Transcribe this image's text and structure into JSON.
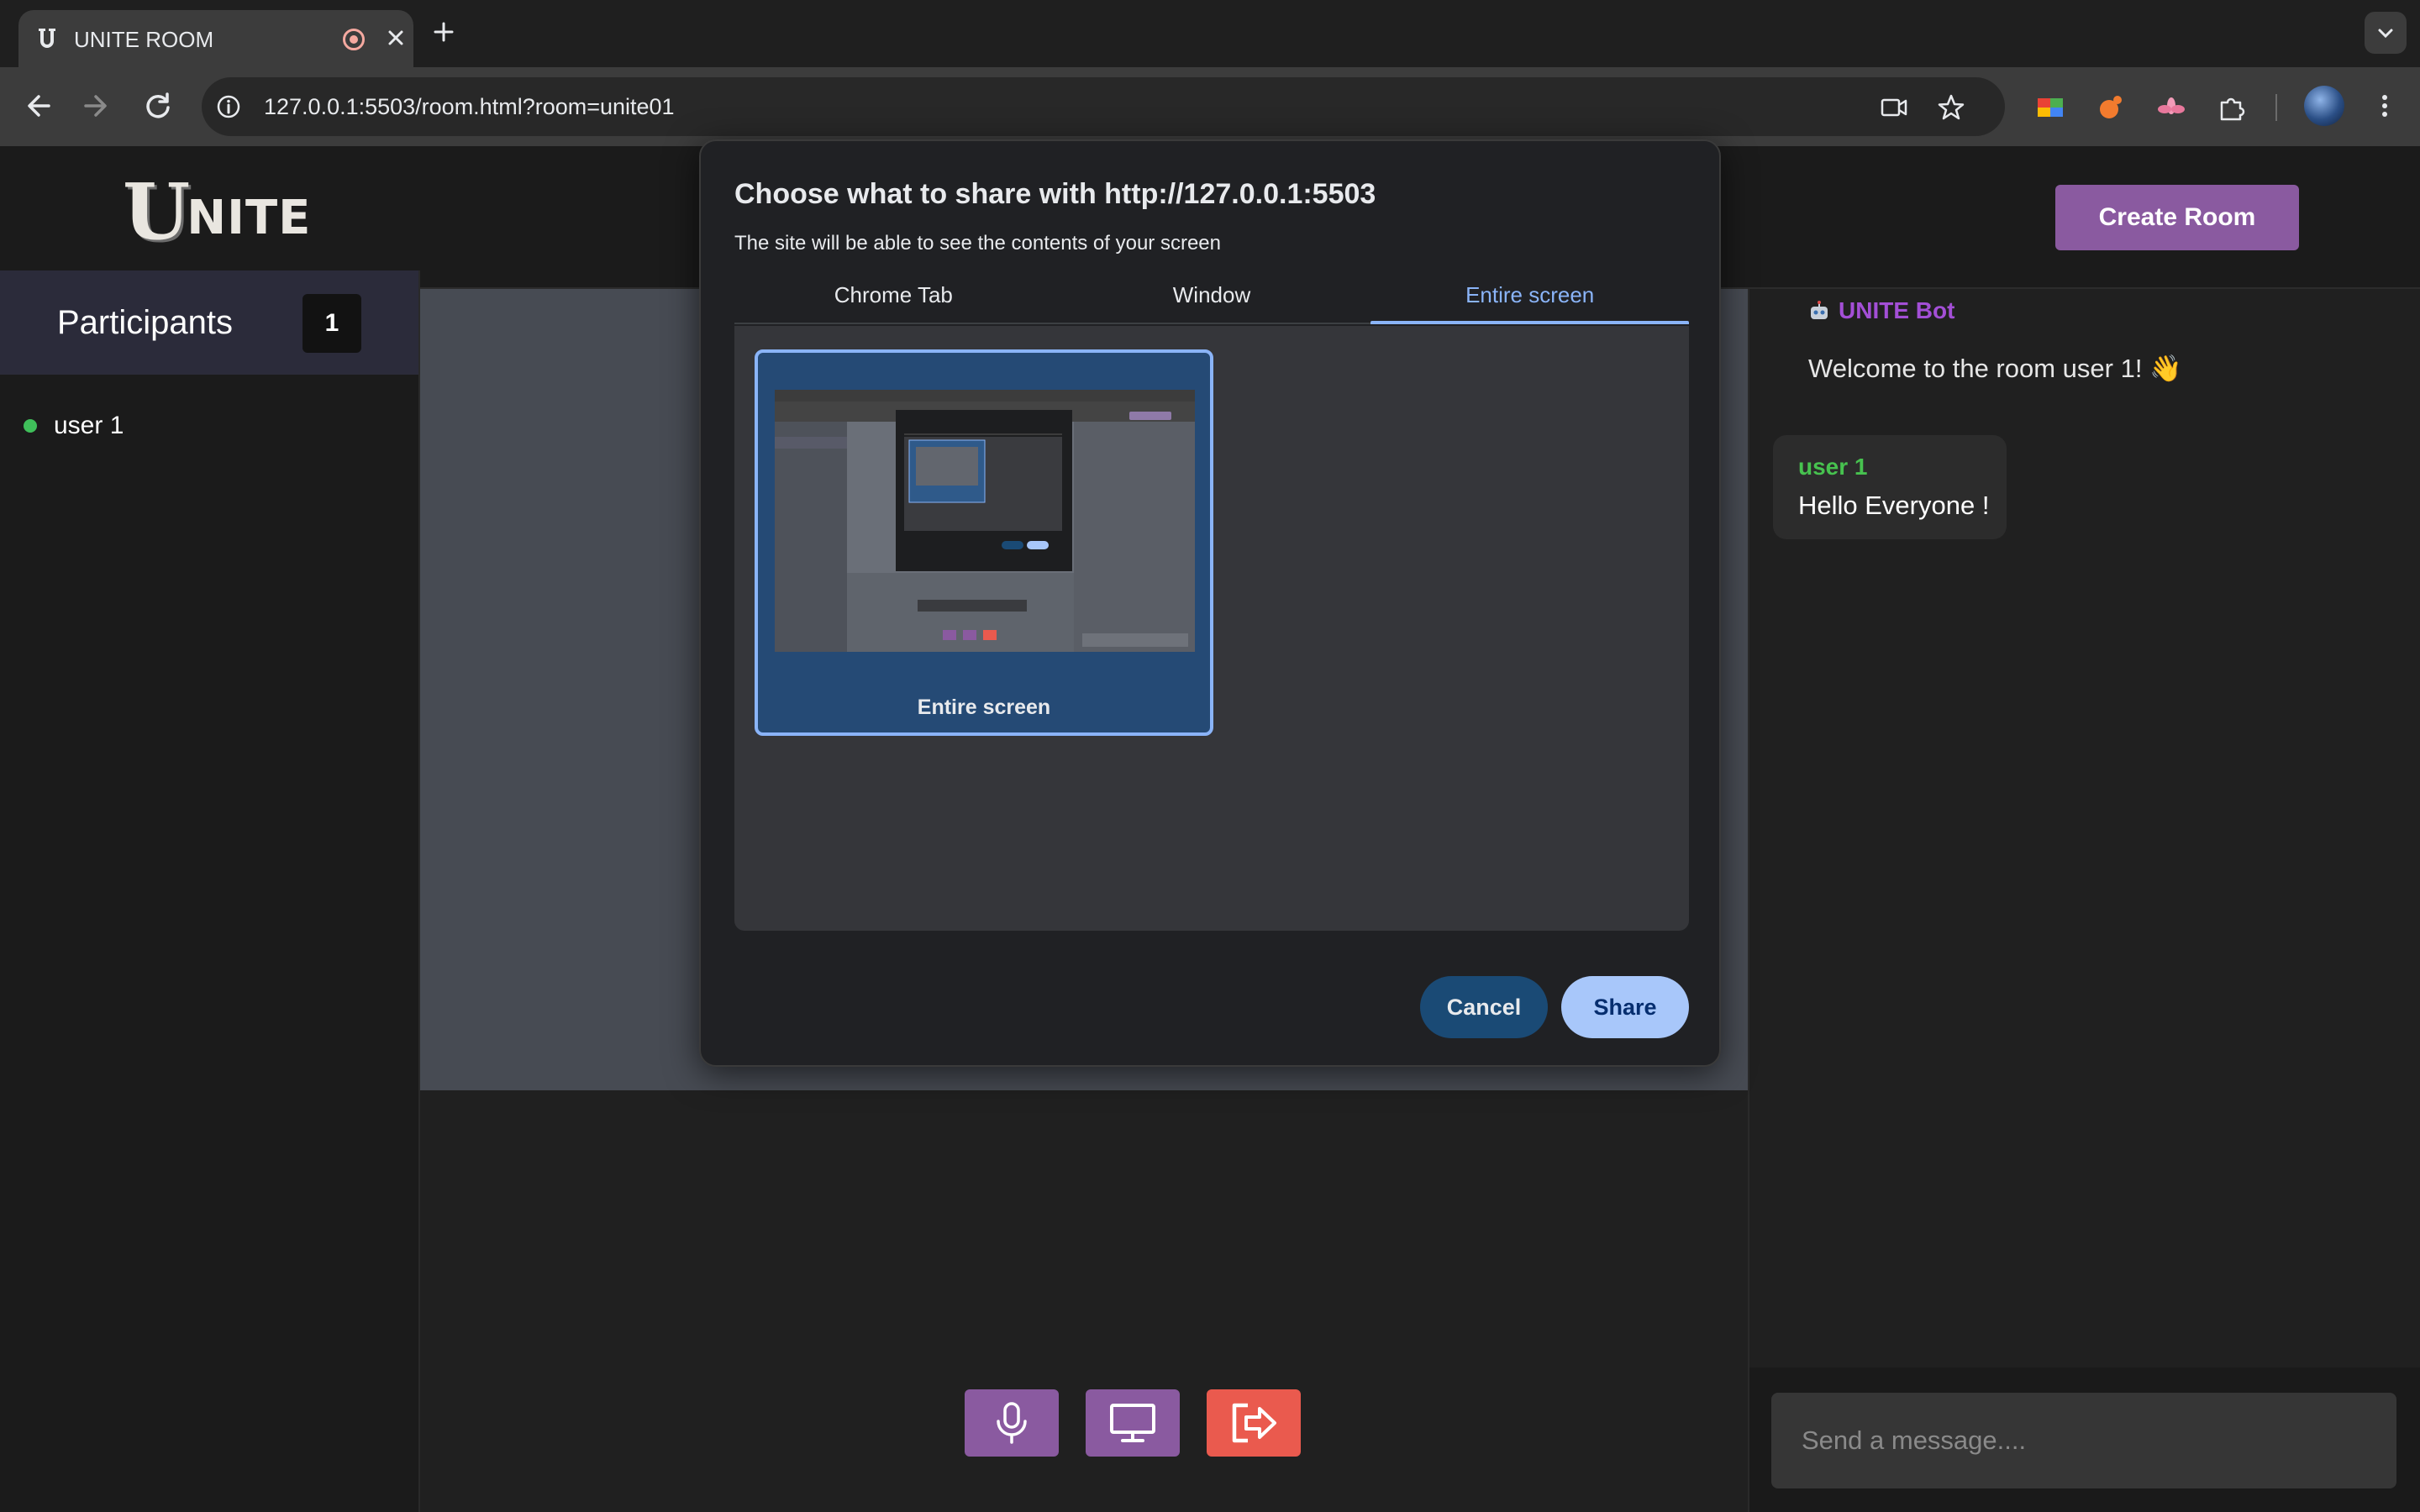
{
  "browser": {
    "tab_title": "UNITE ROOM",
    "url": "127.0.0.1:5503/room.html?room=unite01"
  },
  "header": {
    "logo_initial": "U",
    "logo_rest": "NITE",
    "create_room_label": "Create Room"
  },
  "participants": {
    "title": "Participants",
    "count": "1",
    "items": [
      {
        "name": "user 1",
        "status_color": "#3fbf5a"
      }
    ]
  },
  "chat": {
    "bot_name": "UNITE Bot",
    "bot_message": "Welcome to the room user 1! 👋",
    "messages": [
      {
        "user": "user 1",
        "text": "Hello Everyone !"
      }
    ],
    "input_placeholder": "Send a message...."
  },
  "controls": [
    {
      "name": "microphone-icon"
    },
    {
      "name": "screen-share-icon"
    },
    {
      "name": "leave-icon"
    }
  ],
  "share_dialog": {
    "title": "Choose what to share with http://127.0.0.1:5503",
    "subtitle": "The site will be able to see the contents of your screen",
    "tabs": [
      "Chrome Tab",
      "Window",
      "Entire screen"
    ],
    "active_tab": "Entire screen",
    "source_label": "Entire screen",
    "cancel_label": "Cancel",
    "share_label": "Share"
  },
  "colors": {
    "accent_purple": "#8a5aa0",
    "leave_red": "#ea5a4e",
    "bot_purple": "#a34fd6",
    "user_green": "#47c24f",
    "dialog_accent": "#8ab4f8"
  }
}
